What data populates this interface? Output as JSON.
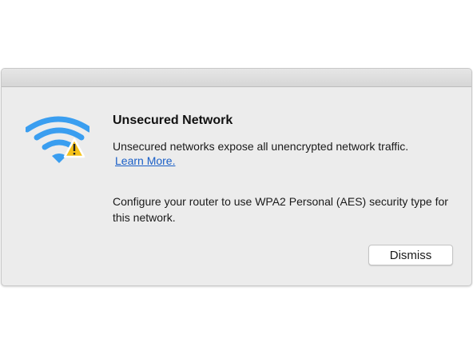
{
  "dialog": {
    "title": "Unsecured Network",
    "message": "Unsecured networks expose all unencrypted network traffic.",
    "learn_more_label": "Learn More.",
    "instruction": "Configure your router to use WPA2 Personal (AES) security type for this network.",
    "dismiss_label": "Dismiss",
    "icon": "wifi-warning-icon"
  },
  "colors": {
    "wifi_blue": "#3a9ef0",
    "warning_yellow": "#f5c21b",
    "link_blue": "#1a5fc7",
    "dialog_bg": "#ececec"
  }
}
